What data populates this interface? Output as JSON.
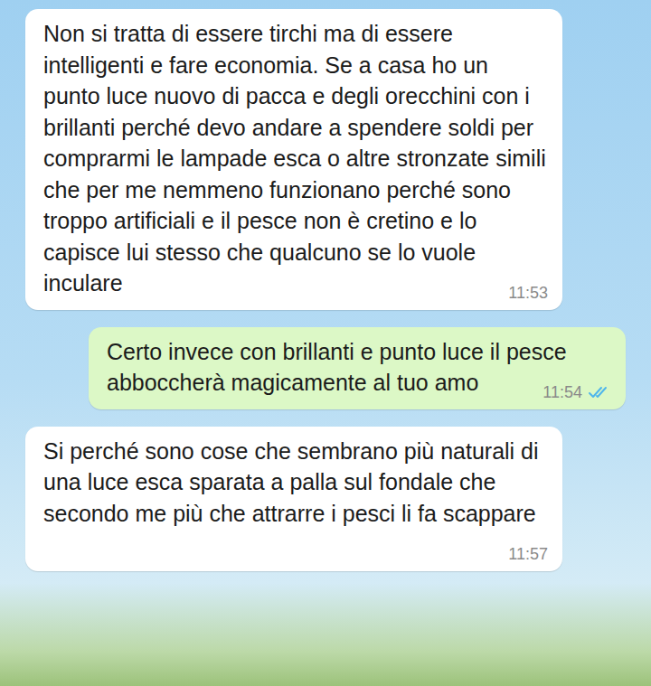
{
  "messages": [
    {
      "text": "Non si tratta di essere tirchi ma di essere intelligenti e fare economia. Se a casa ho un punto luce nuovo di pacca e degli orecchini con i brillanti perché devo andare a spendere soldi per comprarmi le lampade esca o altre stronzate simili che per me nemmeno funzionano perché sono troppo artificiali e il pesce non è cretino e lo capisce lui stesso che qualcuno se lo vuole inculare",
      "time": "11:53",
      "outgoing": false
    },
    {
      "text": "Certo invece con brillanti e punto luce il pesce abboccherà magicamente al tuo amo",
      "time": "11:54",
      "outgoing": true,
      "read": true
    },
    {
      "text": "Si perché sono cose che sembrano più naturali di una luce esca sparata a palla sul fondale che secondo me più che attrarre i pesci li fa scappare",
      "time": "11:57",
      "outgoing": false
    }
  ]
}
